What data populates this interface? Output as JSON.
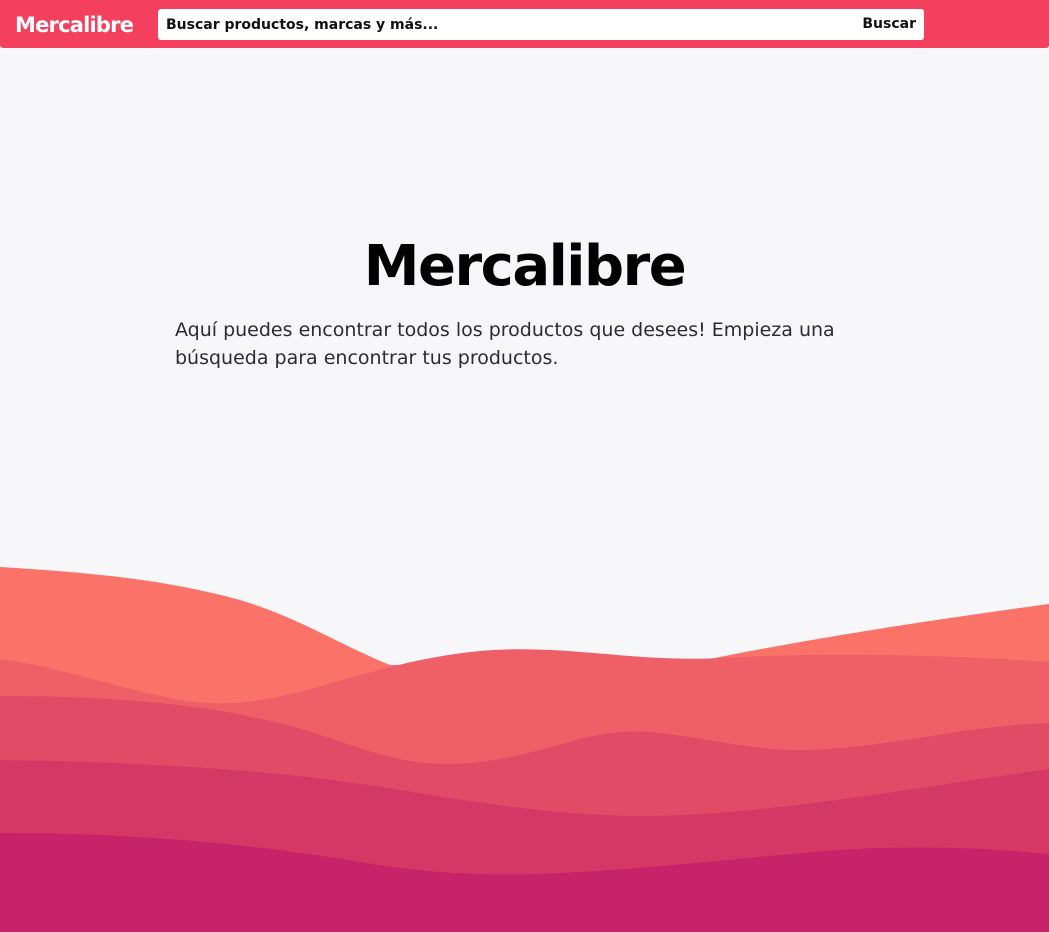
{
  "header": {
    "logo_text": "Mercalibre",
    "search": {
      "placeholder": "Buscar productos, marcas y más...",
      "value": "",
      "button_label": "Buscar"
    }
  },
  "hero": {
    "title": "Mercalibre",
    "description": "Aquí puedes encontrar todos los productos que desees! Empieza una búsqueda para encontrar tus productos."
  },
  "colors": {
    "brand": "#f43f5e",
    "background": "#f7f7f9",
    "wave_layers": [
      "#fb7268",
      "#ef5f67",
      "#e24b66",
      "#d53867",
      "#c62368"
    ]
  }
}
